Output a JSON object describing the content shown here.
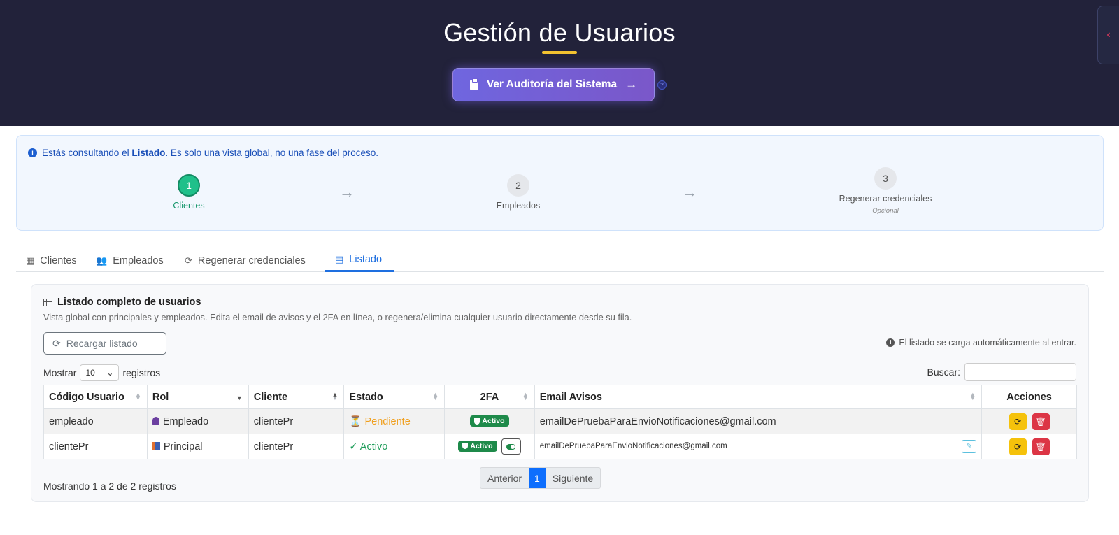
{
  "header": {
    "title": "Gestión de Usuarios",
    "audit_button": "Ver Auditoría del Sistema",
    "help_mark": "?",
    "side_tab_icon": "‹"
  },
  "info": {
    "prefix": "Estás consultando el ",
    "bold": "Listado",
    "suffix": ". Es solo una vista global, no una fase del proceso."
  },
  "steps": [
    {
      "number": "1",
      "label": "Clientes",
      "active": true
    },
    {
      "number": "2",
      "label": "Empleados",
      "active": false
    },
    {
      "number": "3",
      "label": "Regenerar credenciales",
      "sub": "Opcional",
      "active": false
    }
  ],
  "step_arrow": "→",
  "tabs": [
    {
      "label": "Clientes",
      "icon": "building-icon"
    },
    {
      "label": "Empleados",
      "icon": "users-icon"
    },
    {
      "label": "Regenerar credenciales",
      "icon": "sync-icon"
    },
    {
      "label": "Listado",
      "icon": "table-icon",
      "active": true
    }
  ],
  "list": {
    "title": "Listado completo de usuarios",
    "description": "Vista global con principales y empleados. Edita el email de avisos y el 2FA en línea, o regenera/elimina cualquier usuario directamente desde su fila.",
    "reload_button": "Recargar listado",
    "auto_note": "El listado se carga automáticamente al entrar.",
    "show_prefix": "Mostrar",
    "page_length": "10",
    "show_suffix": "registros",
    "search_label": "Buscar:",
    "search_value": "",
    "columns": [
      "Código Usuario",
      "Rol",
      "Cliente",
      "Estado",
      "2FA",
      "Email Avisos",
      "Acciones"
    ],
    "rows": [
      {
        "code": "empleado",
        "role": "Empleado",
        "role_icon": "person-icon",
        "client": "clientePr",
        "status": "Pendiente",
        "status_icon": "hourglass-icon",
        "twofa": "Activo",
        "email": "emailDePruebaParaEnvioNotificaciones@gmail.com"
      },
      {
        "code": "clientePr",
        "role": "Principal",
        "role_icon": "building-icon",
        "client": "clientePr",
        "status": "✓ Activo",
        "twofa": "Activo",
        "email": "emailDePruebaParaEnvioNotificaciones@gmail.com"
      }
    ],
    "info_text": "Mostrando 1 a 2 de 2 registros",
    "pager": {
      "prev": "Anterior",
      "current": "1",
      "next": "Siguiente"
    }
  },
  "colors": {
    "header_bg": "#22223a",
    "accent_yellow": "#f2c230",
    "audit_gradient_start": "#6f66df",
    "audit_gradient_end": "#7a57c9",
    "step_active": "#20c08a",
    "tab_active": "#1e6fe0",
    "badge_green": "#1e8a4a",
    "warn": "#f5c20b",
    "danger": "#dc3545"
  }
}
